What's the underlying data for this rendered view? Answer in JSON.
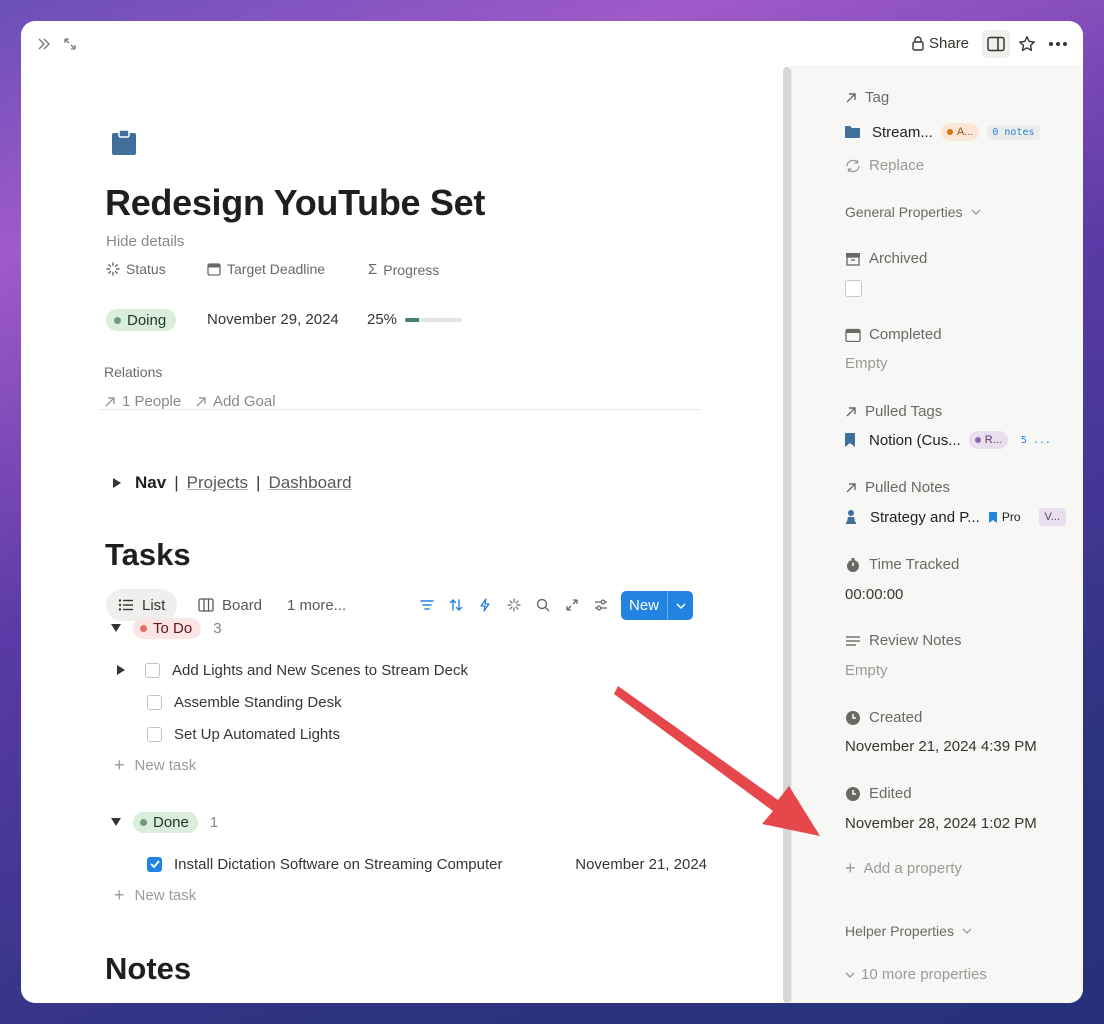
{
  "topbar": {
    "share_label": "Share"
  },
  "page": {
    "title": "Redesign YouTube Set",
    "hide_details": "Hide details",
    "properties": {
      "status_label": "Status",
      "status_value": "Doing",
      "deadline_label": "Target Deadline",
      "deadline_value": "November 29, 2024",
      "progress_label": "Progress",
      "progress_value": "25%",
      "progress_fraction": 0.25
    },
    "relations": {
      "label": "Relations",
      "people": "1 People",
      "add_goal": "Add Goal"
    },
    "nav": {
      "label": "Nav",
      "sep": "|",
      "projects": "Projects",
      "dashboard": "Dashboard"
    },
    "tasks_heading": "Tasks",
    "notes_heading": "Notes"
  },
  "views": {
    "list": "List",
    "board": "Board",
    "more": "1 more...",
    "new_label": "New"
  },
  "groups": {
    "todo": {
      "label": "To Do",
      "count": "3",
      "tasks": [
        "Add Lights and New Scenes to Stream Deck",
        "Assemble Standing Desk",
        "Set Up Automated Lights"
      ],
      "new_task": "New task"
    },
    "done": {
      "label": "Done",
      "count": "1",
      "tasks": [
        "Install Dictation Software on Streaming Computer"
      ],
      "task_date": "November 21, 2024",
      "new_task": "New task"
    }
  },
  "sidebar": {
    "tag_label": "Tag",
    "tag_name": "Stream...",
    "tag_chip": "A...",
    "tag_notes": "0 notes",
    "replace": "Replace",
    "general_properties": "General Properties",
    "archived": "Archived",
    "completed": "Completed",
    "completed_value": "Empty",
    "pulled_tags": "Pulled Tags",
    "pulled_tag_name": "Notion (Cus...",
    "pulled_tag_chip": "R...",
    "pulled_tag_count": "5 ...",
    "pulled_notes": "Pulled Notes",
    "pulled_note_name": "Strategy and P...",
    "pulled_note_extra": "Pro",
    "pulled_note_chip": "V...",
    "time_tracked": "Time Tracked",
    "time_tracked_value": "00:00:00",
    "review_notes": "Review Notes",
    "review_notes_value": "Empty",
    "created": "Created",
    "created_value": "November 21, 2024 4:39 PM",
    "edited": "Edited",
    "edited_value": "November 28, 2024 1:02 PM",
    "add_property": "Add a property",
    "helper_properties": "Helper Properties",
    "more_properties": "10 more properties"
  },
  "colors": {
    "accent": "#2383e2",
    "doing_bg": "#dbeddb",
    "todo_bg": "#fbe4e4",
    "done_bg": "#dbeddb",
    "arrow": "#e5474a"
  }
}
